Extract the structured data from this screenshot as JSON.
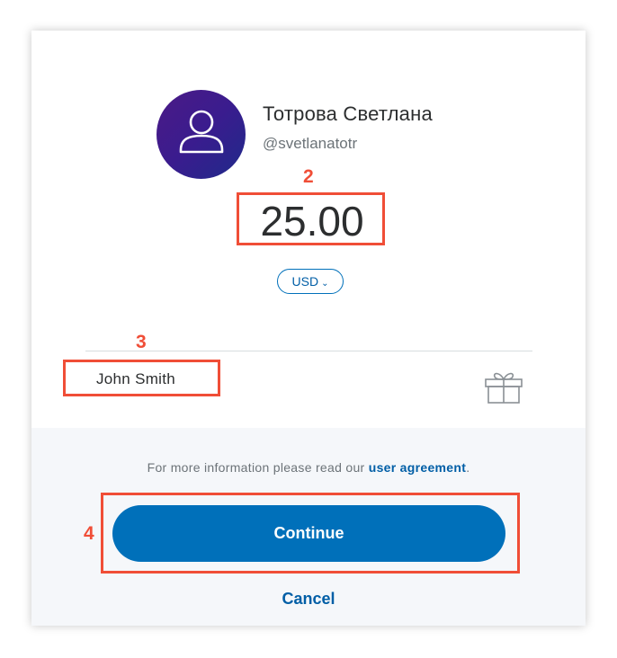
{
  "recipient": {
    "name": "Тотрова Светлана",
    "handle": "@svetlanatotr",
    "avatar_icon": "user-silhouette-icon"
  },
  "payment": {
    "amount": "25.00",
    "currency": "USD",
    "currency_icon": "chevron-down-icon"
  },
  "note": {
    "value": "John Smith",
    "gift_icon": "gift-icon"
  },
  "footer": {
    "info_text": "For more information please read our ",
    "info_link": "user agreement",
    "info_end": ".",
    "continue_label": "Continue",
    "cancel_label": "Cancel"
  },
  "annotations": {
    "amount_number": "2",
    "note_number": "3",
    "continue_number": "4",
    "color": "#f04e37"
  },
  "colors": {
    "primary": "#0070ba",
    "link": "#005ea6",
    "text": "#2c2e2f"
  }
}
